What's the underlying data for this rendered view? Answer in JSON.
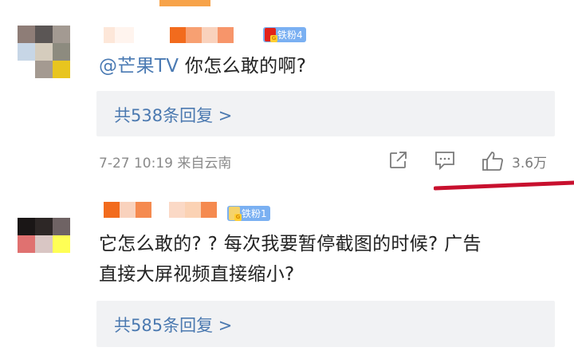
{
  "comments": [
    {
      "badge_text": "铁粉4",
      "mention": "@芒果TV",
      "text": " 你怎么敢的啊?",
      "replies_label": "共538条回复 >",
      "meta": "7-27 10:19 来自云南",
      "likes": "3.6万"
    },
    {
      "badge_text": "铁粉1",
      "text_line1": "它怎么敢的? ? 每次我要暂停截图的时候? 广告",
      "text_line2": "直接大屏视频直接缩小?",
      "replies_label": "共585条回复 >"
    }
  ],
  "icons": {
    "repost": "share-arrow-icon",
    "comment": "comment-bubble-icon",
    "like": "thumbs-up-icon"
  },
  "colors": {
    "mention": "#4a7ab3",
    "reply_link": "#4b79b0",
    "reply_bg": "#f1f2f4",
    "badge": "#7ab0f2",
    "underline": "#c8102e"
  }
}
